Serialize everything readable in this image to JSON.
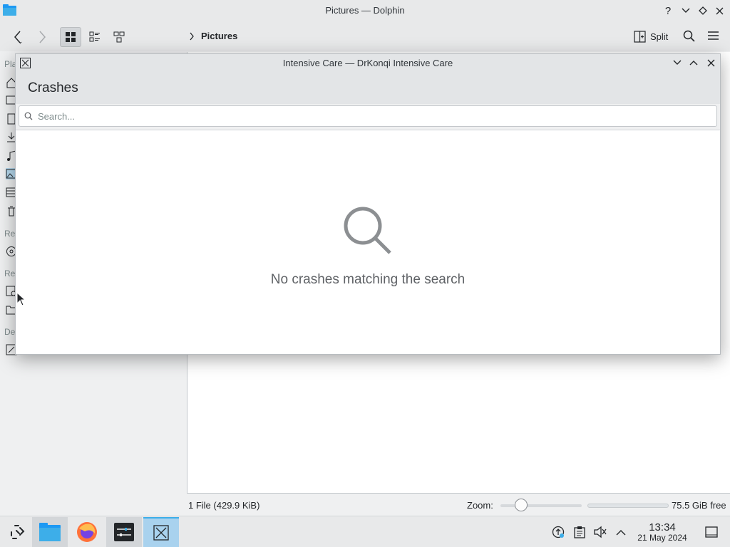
{
  "dolphin": {
    "window_title": "Pictures — Dolphin",
    "help_symbol": "?",
    "breadcrumb": "Pictures",
    "split_label": "Split",
    "places_header_letters": [
      "Pla",
      "Re",
      "Re",
      "De"
    ],
    "status_files": "1 File (429.9 KiB)",
    "zoom_label": "Zoom:",
    "zoom_level": 0.25,
    "free_space": "75.5 GiB free"
  },
  "drkonqi": {
    "window_title": "Intensive Care — DrKonqi Intensive Care",
    "heading": "Crashes",
    "search": {
      "placeholder": "Search...",
      "value": ""
    },
    "empty_message": "No crashes matching the search"
  },
  "taskbar": {
    "apps": [
      "application-launcher-icon",
      "dolphin-icon",
      "firefox-icon",
      "system-settings-icon",
      "drkonqi-icon"
    ],
    "clock_time": "13:34",
    "clock_date": "21 May 2024"
  },
  "colors": {
    "accent": "#3daee9",
    "active_task": "#a9d2ee",
    "folder_blue": "#1d99f3",
    "icon_gray": "#232629"
  }
}
